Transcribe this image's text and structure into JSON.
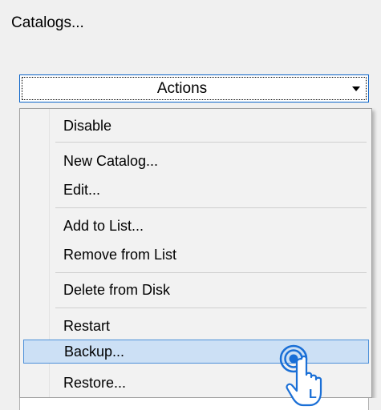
{
  "header": {
    "label": "Catalogs..."
  },
  "combo": {
    "label": "Actions",
    "arrow_icon": "chevron-down-icon"
  },
  "menu": {
    "items": [
      {
        "label": "Disable"
      },
      {
        "label": "New Catalog..."
      },
      {
        "label": "Edit..."
      },
      {
        "label": "Add to List..."
      },
      {
        "label": "Remove from List"
      },
      {
        "label": "Delete from Disk"
      },
      {
        "label": "Restart"
      },
      {
        "label": "Backup...",
        "highlighted": true
      },
      {
        "label": "Restore..."
      }
    ]
  },
  "cursor": {
    "icon": "hand-pointer-click-icon",
    "badge": "L"
  },
  "colors": {
    "highlight_bg": "#cce0f5",
    "highlight_border": "#4c90d9",
    "cursor_accent": "#1a6fd6"
  }
}
